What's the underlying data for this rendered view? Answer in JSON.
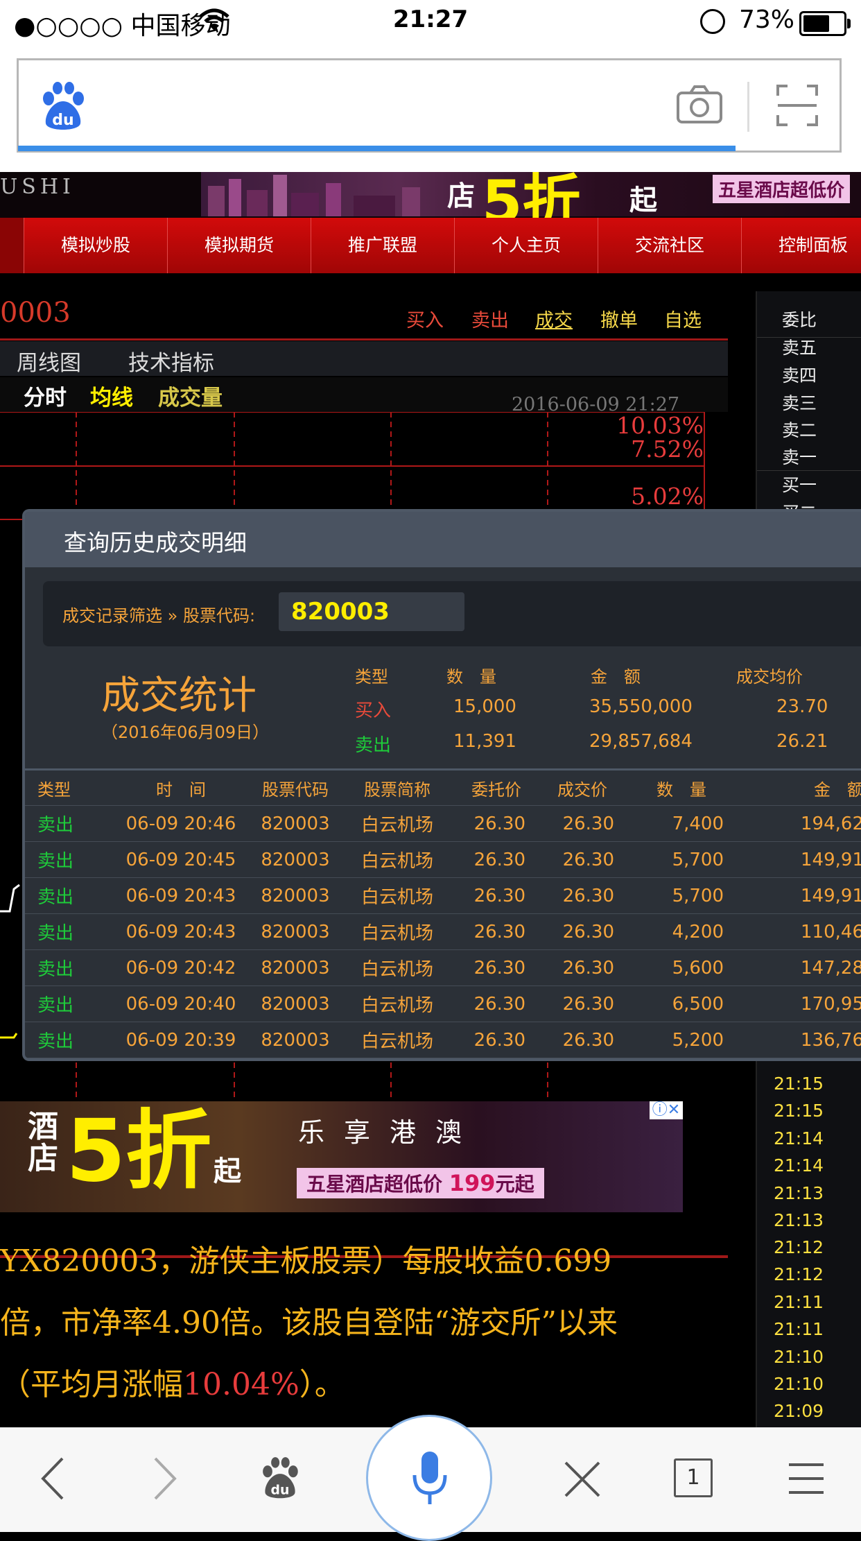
{
  "status_bar": {
    "carrier": "●○○○○ 中国移动",
    "time": "21:27",
    "battery": "73%",
    "battery_level": 0.73
  },
  "browser": {
    "load_progress": 0.87
  },
  "site": {
    "logo": "USHI",
    "banner": {
      "small": "店",
      "big": "5折",
      "qi": "起",
      "tag": "五星酒店超低价"
    },
    "nav": [
      "模拟炒股",
      "模拟期货",
      "推广联盟",
      "个人主页",
      "交流社区",
      "控制面板"
    ],
    "stock_code": "0003",
    "actions": [
      "买入",
      "卖出",
      "成交",
      "撤单",
      "自选"
    ],
    "chart_tabs": [
      "周线图",
      "技术指标"
    ],
    "chart_sub": [
      "分时",
      "均线",
      "成交量"
    ],
    "chart_date": "2016-06-09 21:27",
    "pct_labels": [
      "10.03%",
      "7.52%",
      "5.02%"
    ],
    "side_labels": [
      "委比",
      "卖五",
      "卖四",
      "卖三",
      "卖二",
      "卖一",
      "买一",
      "买二"
    ],
    "side_times": [
      "21:15",
      "21:15",
      "21:14",
      "21:14",
      "21:13",
      "21:13",
      "21:12",
      "21:12",
      "21:11",
      "21:11",
      "21:10",
      "21:10",
      "21:09"
    ],
    "ad": {
      "hotel": "酒\n店",
      "big": "5折",
      "qi": "起",
      "slogan": "乐享港澳",
      "tag_pre": "五星酒店超低价",
      "tag_price": "199",
      "tag_post": "元起"
    },
    "para_lines": [
      "YX820003，游侠主板股票）每股收益0.699",
      "倍，市净率4.90倍。该股自登陆“游交所”以来",
      "（平均月涨幅",
      "10.04%",
      "）。"
    ]
  },
  "modal": {
    "title": "查询历史成交明细",
    "filter_label": "成交记录筛选 » 股票代码:",
    "filter_value": "820003",
    "stats_title": "成交统计",
    "stats_date": "（2016年06月09日）",
    "stats_headers": [
      "类型",
      "数　量",
      "金　额",
      "成交均价"
    ],
    "stats_rows": [
      [
        "买入",
        "15,000",
        "35,550,000",
        "23.70"
      ],
      [
        "卖出",
        "11,391",
        "29,857,684",
        "26.21"
      ]
    ],
    "table_headers": [
      "类型",
      "时　间",
      "股票代码",
      "股票简称",
      "委托价",
      "成交价",
      "数　量",
      "金　额"
    ],
    "table_rows": [
      [
        "卖出",
        "06-09 20:46",
        "820003",
        "白云机场",
        "26.30",
        "26.30",
        "7,400",
        "194,62"
      ],
      [
        "卖出",
        "06-09 20:45",
        "820003",
        "白云机场",
        "26.30",
        "26.30",
        "5,700",
        "149,91"
      ],
      [
        "卖出",
        "06-09 20:43",
        "820003",
        "白云机场",
        "26.30",
        "26.30",
        "5,700",
        "149,91"
      ],
      [
        "卖出",
        "06-09 20:43",
        "820003",
        "白云机场",
        "26.30",
        "26.30",
        "4,200",
        "110,46"
      ],
      [
        "卖出",
        "06-09 20:42",
        "820003",
        "白云机场",
        "26.30",
        "26.30",
        "5,600",
        "147,28"
      ],
      [
        "卖出",
        "06-09 20:40",
        "820003",
        "白云机场",
        "26.30",
        "26.30",
        "6,500",
        "170,95"
      ],
      [
        "卖出",
        "06-09 20:39",
        "820003",
        "白云机场",
        "26.30",
        "26.30",
        "5,200",
        "136,76"
      ]
    ]
  },
  "toolbar": {
    "tab_count": "1"
  },
  "colors": {
    "nav_red": "#c00808",
    "orange": "#f6a43a",
    "green": "#1ecc3a",
    "yellow": "#ffee00",
    "accent_blue": "#3a8ee8"
  }
}
